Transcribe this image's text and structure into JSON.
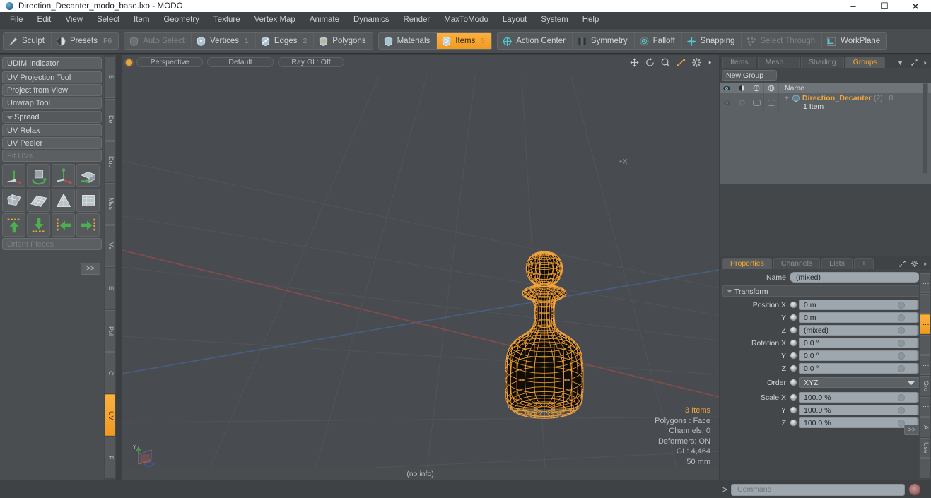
{
  "window": {
    "title": "Direction_Decanter_modo_base.lxo - MODO",
    "app_icon": "modo-sphere-icon",
    "buttons": [
      {
        "name": "minimize-button",
        "glyph": "–"
      },
      {
        "name": "maximize-button",
        "glyph": "☐"
      },
      {
        "name": "close-button",
        "glyph": "✕"
      }
    ]
  },
  "menubar": {
    "items": [
      "File",
      "Edit",
      "View",
      "Select",
      "Item",
      "Geometry",
      "Texture",
      "Vertex Map",
      "Animate",
      "Dynamics",
      "Render",
      "MaxToModo",
      "Layout",
      "System",
      "Help"
    ]
  },
  "toolbar": {
    "groups": [
      {
        "name": "sculpt-presets-group",
        "buttons": [
          {
            "label": "Sculpt",
            "icon": "brush-icon",
            "state": "normal",
            "num": ""
          },
          {
            "label": "Presets",
            "icon": "sphere-icon",
            "state": "normal",
            "num": "F6"
          }
        ]
      },
      {
        "name": "selection-mode-group",
        "buttons": [
          {
            "label": "Auto Select",
            "icon": "shield-icon",
            "state": "dim",
            "num": ""
          },
          {
            "label": "Vertices",
            "icon": "vertex-icon",
            "state": "normal",
            "num": "1"
          },
          {
            "label": "Edges",
            "icon": "edge-icon",
            "state": "normal",
            "num": "2"
          },
          {
            "label": "Polygons",
            "icon": "polygon-icon",
            "state": "normal",
            "num": ""
          }
        ]
      },
      {
        "name": "materials-items-group",
        "buttons": [
          {
            "label": "Materials",
            "icon": "material-icon",
            "state": "normal",
            "num": ""
          },
          {
            "label": "Items",
            "icon": "items-icon",
            "state": "active",
            "num": "5"
          }
        ]
      },
      {
        "name": "modifiers-group",
        "buttons": [
          {
            "label": "Action Center",
            "icon": "action-center-icon",
            "state": "normal",
            "num": ""
          },
          {
            "label": "Symmetry",
            "icon": "symmetry-icon",
            "state": "normal",
            "num": ""
          },
          {
            "label": "Falloff",
            "icon": "falloff-icon",
            "state": "normal",
            "num": ""
          },
          {
            "label": "Snapping",
            "icon": "snapping-icon",
            "state": "normal",
            "num": ""
          },
          {
            "label": "Select Through",
            "icon": "select-through-icon",
            "state": "dim",
            "num": ""
          },
          {
            "label": "WorkPlane",
            "icon": "workplane-icon",
            "state": "normal",
            "num": ""
          }
        ]
      }
    ]
  },
  "left_panel": {
    "top_button": "UDIM Indicator",
    "uv_tools": [
      "UV Projection Tool",
      "Project from View",
      "Unwrap Tool"
    ],
    "spread_header": "Spread",
    "spread_tools": [
      {
        "label": "UV Relax",
        "state": "normal"
      },
      {
        "label": "UV Peeler",
        "state": "normal"
      },
      {
        "label": "Fit UVs",
        "state": "dim"
      }
    ],
    "icon_rows": [
      [
        "move-uv-icon",
        "rotate-uv-icon",
        "scale-uv-icon",
        "flip-uv-icon"
      ],
      [
        "fit-mesh-icon",
        "grid-uv-icon",
        "cone-uv-icon",
        "box-uv-icon"
      ],
      [
        "align-up-icon",
        "align-down-icon",
        "align-left-icon",
        "align-right-icon"
      ]
    ],
    "orient_pieces": "Orient Pieces",
    "more_button": ">>",
    "vertical_tabs": [
      {
        "label": "B",
        "active": false
      },
      {
        "label": "De",
        "active": false
      },
      {
        "label": "Dup",
        "active": false
      },
      {
        "label": "Mes",
        "active": false
      },
      {
        "label": "Ve",
        "active": false
      },
      {
        "label": "E",
        "active": false
      },
      {
        "label": "Pol",
        "active": false
      },
      {
        "label": "C",
        "active": false
      },
      {
        "label": "UV",
        "active": true
      },
      {
        "label": "F",
        "active": false
      }
    ]
  },
  "viewport": {
    "pills": [
      "Perspective",
      "Default",
      "Ray GL: Off"
    ],
    "nav_icons": [
      "pan-icon",
      "rotate-icon",
      "zoom-icon",
      "fit-icon",
      "gear-icon",
      "arrow-right-icon"
    ],
    "axis_label_x": "+X",
    "gizmo_label": "Y",
    "stats": [
      "3 Items",
      "Polygons : Face",
      "Channels: 0",
      "Deformers: ON",
      "GL: 4,464",
      "50 mm"
    ],
    "status_text": "(no info)",
    "model_name": "decanter-wireframe",
    "wire_color": "#f2a33c"
  },
  "groups_panel": {
    "tabs": [
      {
        "label": "Items",
        "active": false
      },
      {
        "label": "Mesh ...",
        "active": false
      },
      {
        "label": "Shading",
        "active": false
      },
      {
        "label": "Groups",
        "active": true
      }
    ],
    "caret": "▼",
    "expand_icon": "expand-icon",
    "arrow_icon": "arrow-right-icon",
    "new_group_button": "New Group",
    "columns": [
      {
        "name": "visibility-column",
        "icon": "eye-icon"
      },
      {
        "name": "render-column",
        "icon": "half-circle-icon"
      },
      {
        "name": "lock-column",
        "icon": "lock-icon"
      },
      {
        "name": "wireframe-column",
        "icon": "wire-icon"
      },
      {
        "name": "name-column",
        "label": "Name"
      }
    ],
    "rows": [
      {
        "expander": "+",
        "icon": "group-sphere-icon",
        "name": "Direction_Decanter",
        "meta": "(2) : 0...",
        "sub": "1 Item"
      }
    ]
  },
  "properties_panel": {
    "tabs": [
      {
        "label": "Properties",
        "active": true
      },
      {
        "label": "Channels",
        "active": false
      },
      {
        "label": "Lists",
        "active": false
      },
      {
        "label": "+",
        "active": false
      }
    ],
    "expand_icon": "expand-icon",
    "gear_icon": "gear-icon",
    "arrow_icon": "arrow-right-icon",
    "name_label": "Name",
    "name_value": "(mixed)",
    "section_transform": "Transform",
    "fields": [
      {
        "label": "Position X",
        "value": "0 m",
        "type": "value"
      },
      {
        "label": "Y",
        "value": "0 m",
        "type": "value"
      },
      {
        "label": "Z",
        "value": "(mixed)",
        "type": "value"
      },
      {
        "label": "Rotation X",
        "value": "0.0 °",
        "type": "value"
      },
      {
        "label": "Y",
        "value": "0.0 °",
        "type": "value"
      },
      {
        "label": "Z",
        "value": "0.0 °",
        "type": "value"
      },
      {
        "label": "Order",
        "value": "XYZ",
        "type": "dropdown"
      },
      {
        "label": "Scale X",
        "value": "100.0 %",
        "type": "value"
      },
      {
        "label": "Y",
        "value": "100.0 %",
        "type": "value"
      },
      {
        "label": "Z",
        "value": "100.0 %",
        "type": "value"
      }
    ],
    "more_button": ">>",
    "vertical_tabs": [
      {
        "label": "⋮",
        "active": false
      },
      {
        "label": "⋮",
        "active": false
      },
      {
        "label": "⋮",
        "active": true
      },
      {
        "label": "⋮",
        "active": false
      },
      {
        "label": "⋮",
        "active": false
      },
      {
        "label": "Gro",
        "active": false
      },
      {
        "label": "⋮",
        "active": false
      },
      {
        "label": "A",
        "active": false
      },
      {
        "label": "Use",
        "active": false
      },
      {
        "label": "⋮",
        "active": false
      }
    ]
  },
  "command_bar": {
    "caret": ">",
    "placeholder": "Command",
    "record_icon": "record-icon"
  },
  "colors": {
    "accent": "#f0a83c",
    "panel_bg": "#43474a",
    "viewport_bg": "#484c50",
    "toolbar_bg": "#494d50"
  }
}
